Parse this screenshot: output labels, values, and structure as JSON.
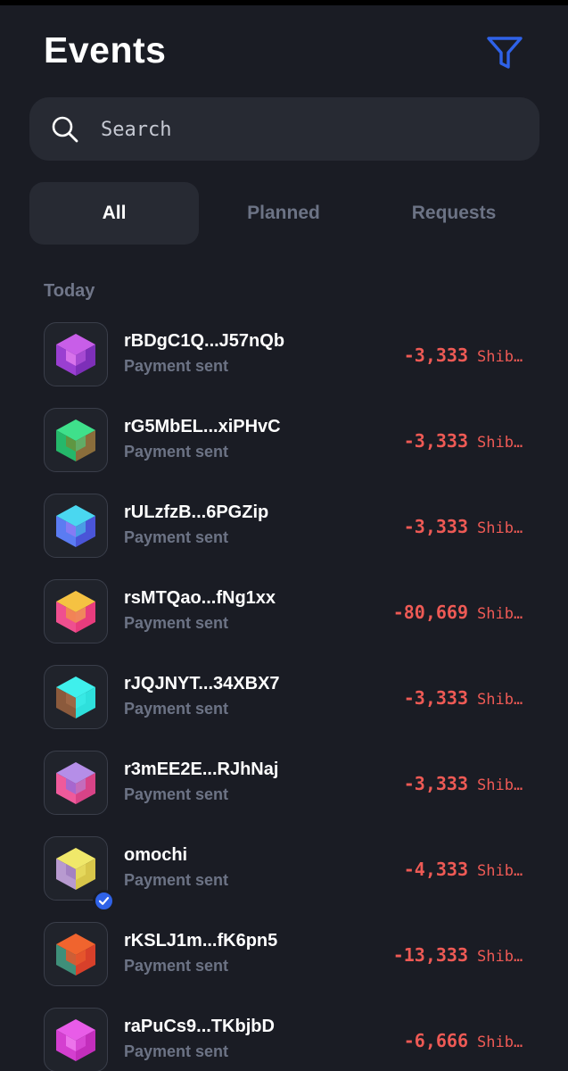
{
  "header": {
    "title": "Events",
    "filter_icon": "filter-icon"
  },
  "search": {
    "placeholder": "Search",
    "value": "",
    "icon": "search-icon"
  },
  "tabs": [
    {
      "label": "All",
      "active": true
    },
    {
      "label": "Planned",
      "active": false
    },
    {
      "label": "Requests",
      "active": false
    }
  ],
  "sections": [
    {
      "label": "Today",
      "events": [
        {
          "name": "rBDgC1Q...J57nQb",
          "subtitle": "Payment sent",
          "amount": "-3,333",
          "currency": "Shib…",
          "verified": false,
          "colors": [
            "#c85ee8",
            "#9a3fd1",
            "#7d2fb8",
            "#e27bf0"
          ]
        },
        {
          "name": "rG5MbEL...xiPHvC",
          "subtitle": "Payment sent",
          "amount": "-3,333",
          "currency": "Shib…",
          "verified": false,
          "colors": [
            "#3fe08b",
            "#25b86a",
            "#8a6d3b",
            "#6a8f3a"
          ]
        },
        {
          "name": "rULzfzB...6PGZip",
          "subtitle": "Payment sent",
          "amount": "-3,333",
          "currency": "Shib…",
          "verified": false,
          "colors": [
            "#4ad7f0",
            "#5b7cf2",
            "#4a55d8",
            "#8e7bf5"
          ]
        },
        {
          "name": "rsMTQao...fNg1xx",
          "subtitle": "Payment sent",
          "amount": "-80,669",
          "currency": "Shib…",
          "verified": false,
          "colors": [
            "#f5c242",
            "#ef4f8f",
            "#e83c7d",
            "#f28c4c"
          ]
        },
        {
          "name": "rJQJNYT...34XBX7",
          "subtitle": "Payment sent",
          "amount": "-3,333",
          "currency": "Shib…",
          "verified": false,
          "colors": [
            "#3ff0ec",
            "#8b5a3c",
            "#2ee0dc",
            "#a06a48"
          ]
        },
        {
          "name": "r3mEE2E...RJhNaj",
          "subtitle": "Payment sent",
          "amount": "-3,333",
          "currency": "Shib…",
          "verified": false,
          "colors": [
            "#b58ee8",
            "#ef5a9b",
            "#d84387",
            "#9a6ad8"
          ]
        },
        {
          "name": "omochi",
          "subtitle": "Payment sent",
          "amount": "-4,333",
          "currency": "Shib…",
          "verified": true,
          "colors": [
            "#f0e86a",
            "#b89ad0",
            "#d8c64a",
            "#a07ebf"
          ]
        },
        {
          "name": "rKSLJ1m...fK6pn5",
          "subtitle": "Payment sent",
          "amount": "-13,333",
          "currency": "Shib…",
          "verified": false,
          "colors": [
            "#f0642e",
            "#3f8f7a",
            "#d8402a",
            "#e8562a"
          ]
        },
        {
          "name": "raPuCs9...TKbjbD",
          "subtitle": "Payment sent",
          "amount": "-6,666",
          "currency": "Shib…",
          "verified": false,
          "colors": [
            "#e85ce8",
            "#d43fd0",
            "#c32ebc",
            "#f07cf0"
          ]
        }
      ]
    }
  ]
}
